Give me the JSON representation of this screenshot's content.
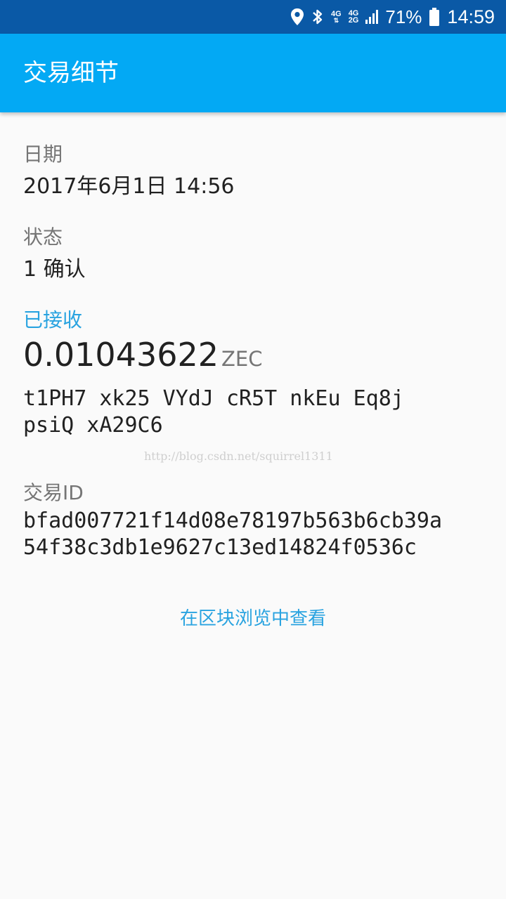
{
  "status_bar": {
    "net_top": "4G",
    "net_left": "4G",
    "net_right": "2G",
    "battery_pct": "71%",
    "clock": "14:59",
    "icons": [
      "location-icon",
      "bluetooth-icon",
      "signal-icon",
      "battery-icon"
    ]
  },
  "app_bar": {
    "title": "交易细节"
  },
  "date": {
    "label": "日期",
    "value": "2017年6月1日 14:56"
  },
  "status": {
    "label": "状态",
    "value": "1 确认"
  },
  "received": {
    "label": "已接收",
    "amount": "0.01043622",
    "unit": "ZEC",
    "address_line1": "t1PH7 xk25 VYdJ cR5T nkEu Eq8j",
    "address_line2": "psiQ xA29C6"
  },
  "watermark": "http://blog.csdn.net/squirrel1311",
  "tx_id": {
    "label": "交易ID",
    "line1": "bfad007721f14d08e78197b563b6cb39a",
    "line2": "54f38c3db1e9627c13ed14824f0536c"
  },
  "explorer_link": "在区块浏览中查看",
  "colors": {
    "status_bar": "#0a59a6",
    "app_bar": "#03a9f4",
    "accent": "#29a3e0",
    "background": "#fafafa"
  }
}
